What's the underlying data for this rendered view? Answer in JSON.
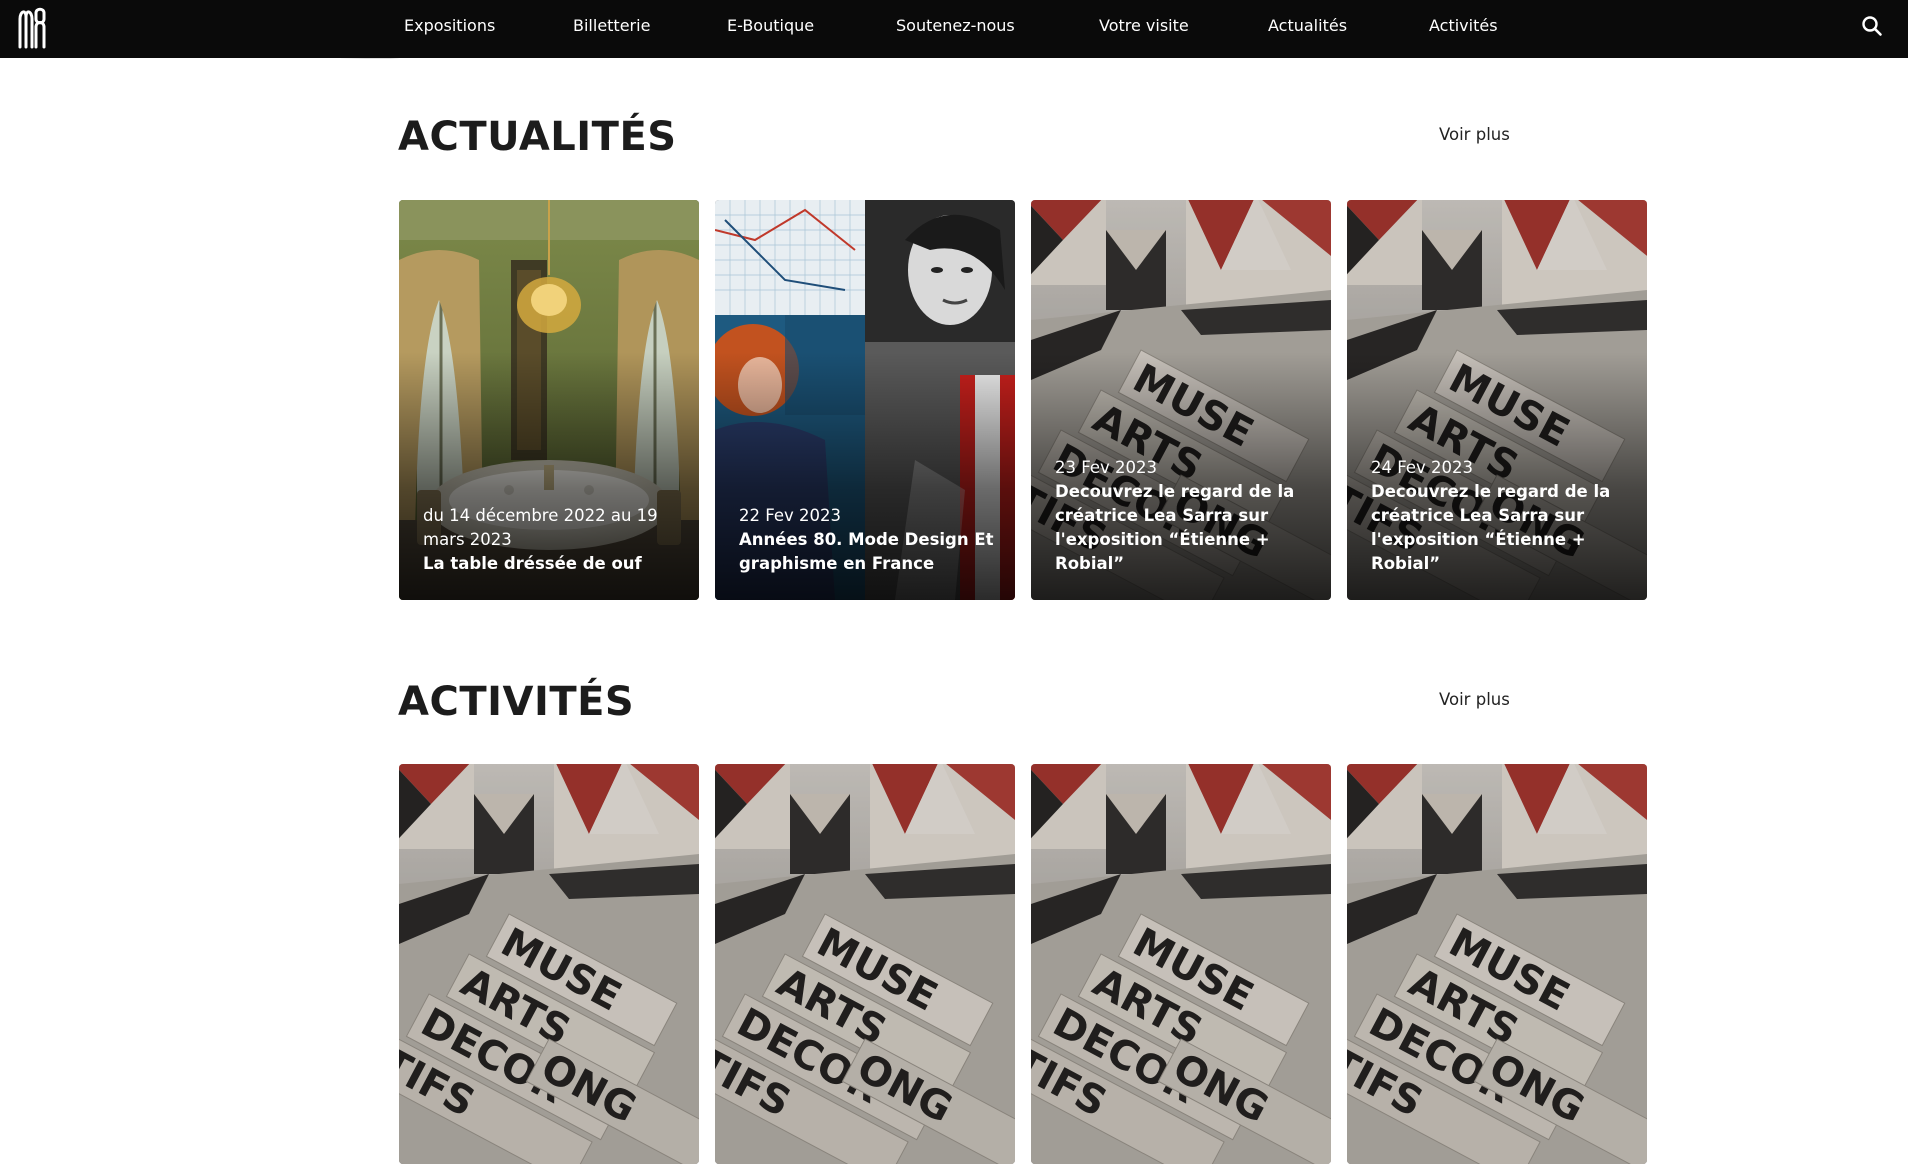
{
  "nav": {
    "items": [
      {
        "label": "Expositions"
      },
      {
        "label": "Billetterie"
      },
      {
        "label": "E-Boutique"
      },
      {
        "label": "Soutenez-nous"
      },
      {
        "label": "Votre visite"
      },
      {
        "label": "Actualités"
      },
      {
        "label": "Activités"
      }
    ],
    "search_icon": "search-icon",
    "logo_icon": "mad-logo-icon"
  },
  "colors": {
    "topbar": "#0a0a0a",
    "text_dark": "#1c1c1c",
    "card_text": "#ffffff",
    "accent_red": "#a8302a"
  },
  "actualites": {
    "title": "ACTUALITÉS",
    "more_label": "Voir plus",
    "cards": [
      {
        "date": "du 14 décembre 2022 au 19 mars 2023",
        "title": "La table dréssée de ouf",
        "image": "dining-room-photo"
      },
      {
        "date": "22 Fev 2023",
        "title": "Années 80. Mode Design Et graphisme en France",
        "image": "eighties-collage-photo"
      },
      {
        "date": "23 Fev 2023",
        "title": "Decouvrez le regard de la créatrice Lea Sarra sur l'exposition “Étienne + Robial”",
        "image": "letter-blocks-photo"
      },
      {
        "date": "24 Fev 2023",
        "title": "Decouvrez le regard de la créatrice Lea Sarra sur l'exposition “Étienne + Robial”",
        "image": "letter-blocks-photo"
      }
    ]
  },
  "activites": {
    "title": "ACTIVITÉS",
    "more_label": "Voir plus",
    "cards": [
      {
        "image": "letter-blocks-photo"
      },
      {
        "image": "letter-blocks-photo"
      },
      {
        "image": "letter-blocks-photo"
      },
      {
        "image": "letter-blocks-photo"
      }
    ]
  }
}
